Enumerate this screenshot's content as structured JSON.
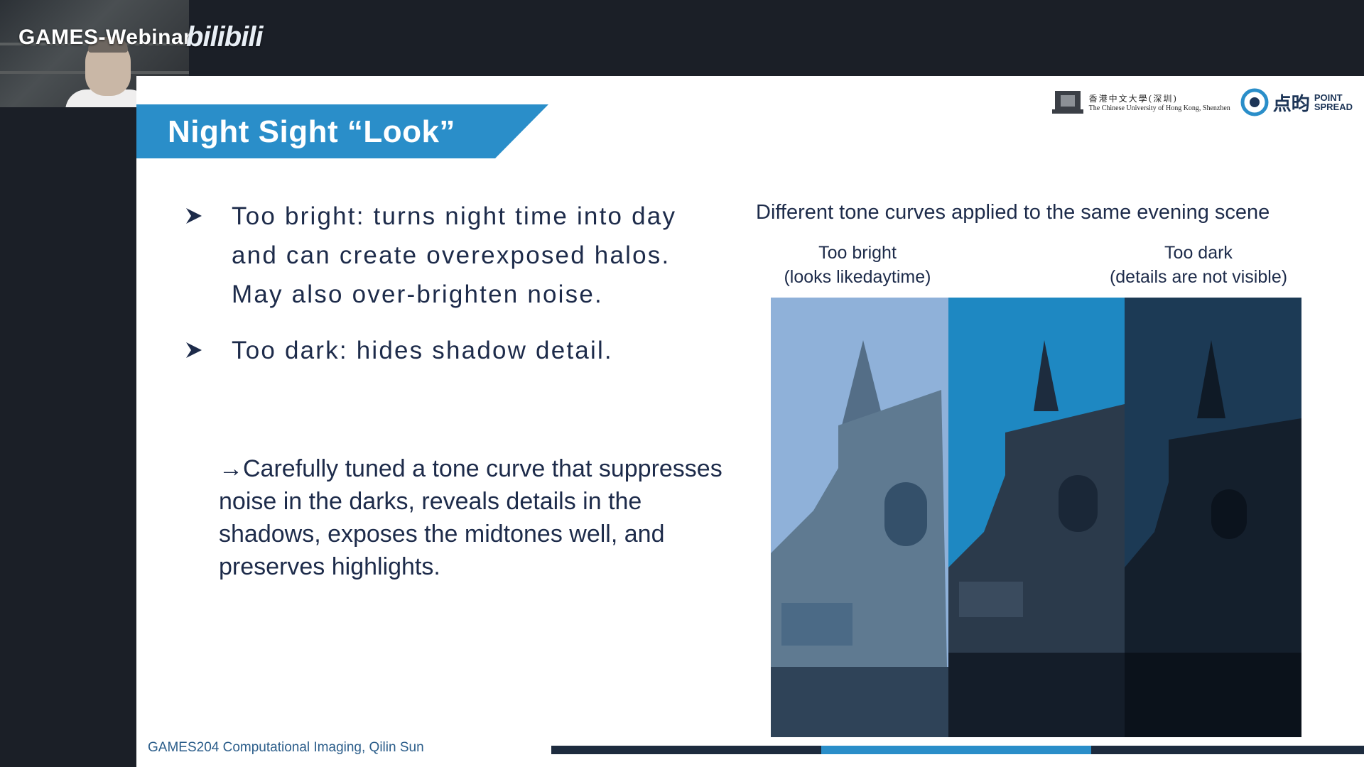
{
  "stream": {
    "brand_text": "GAMES-Webinar",
    "platform_logo": "bilibili"
  },
  "slide": {
    "title": "Night Sight “Look”",
    "logos": {
      "cuhk_cn": "香港中文大學(深圳)",
      "cuhk_en": "The Chinese University of Hong Kong, Shenzhen",
      "pointspread_cn": "点昀",
      "pointspread_en_1": "POINT",
      "pointspread_en_2": "SPREAD"
    },
    "bullets": [
      "Too bright: turns night time into day and can create overexposed halos. May also over-brighten noise.",
      "Too dark: hides shadow detail."
    ],
    "note": "→Carefully tuned a tone curve that suppresses noise in the darks, reveals details in the shadows, exposes the midtones well, and preserves highlights.",
    "figure": {
      "caption": "Different tone curves  applied to the same evening scene",
      "label_bright_1": "Too bright",
      "label_bright_2": "(looks likedaytime)",
      "label_dark_1": "Too dark",
      "label_dark_2": "(details are not visible)"
    },
    "footer": "GAMES204 Computational Imaging, Qilin Sun"
  },
  "colors": {
    "accent_blue": "#2a8ec9",
    "text_navy": "#1d2b4a",
    "footer_blue": "#2b5d8a"
  }
}
